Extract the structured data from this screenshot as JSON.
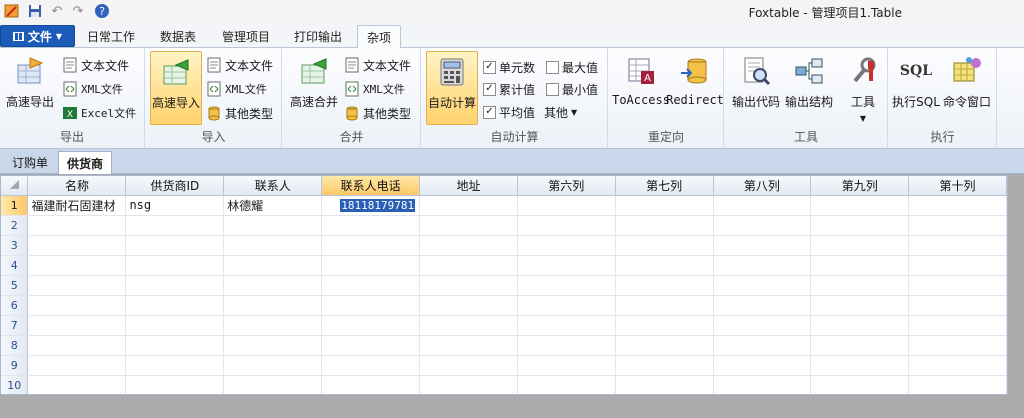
{
  "titlebar": {
    "title": "Foxtable - 管理项目1.Table"
  },
  "ribbon_tabs": {
    "file": "文件",
    "tabs": [
      "日常工作",
      "数据表",
      "管理项目",
      "打印输出",
      "杂项"
    ]
  },
  "groups": {
    "export": {
      "label": "导出",
      "big": "高速导出",
      "items": [
        "文本文件",
        "XML文件",
        "Excel文件"
      ]
    },
    "import": {
      "label": "导入",
      "big": "高速导入",
      "items": [
        "文本文件",
        "XML文件",
        "其他类型"
      ]
    },
    "merge": {
      "label": "合并",
      "big": "高速合并",
      "items": [
        "文本文件",
        "XML文件",
        "其他类型"
      ]
    },
    "autocalc": {
      "label": "自动计算",
      "big": "自动计算",
      "checks": [
        {
          "label": "单元数",
          "checked": "✓"
        },
        {
          "label": "最大值",
          "checked": ""
        },
        {
          "label": "累计值",
          "checked": "✓"
        },
        {
          "label": "最小值",
          "checked": ""
        },
        {
          "label": "平均值",
          "checked": "✓"
        }
      ],
      "other": "其他"
    },
    "redirect": {
      "label": "重定向",
      "toaccess": "ToAccess",
      "redirect": "Redirect"
    },
    "tools": {
      "label": "工具",
      "export_code": "输出代码",
      "export_struct": "输出结构",
      "tools": "工具"
    },
    "execute": {
      "label": "执行",
      "sql_icon_text": "SQL",
      "exec_sql": "执行SQL",
      "cmd_window": "命令窗口"
    }
  },
  "sheet_tabs": [
    "订购单",
    "供货商"
  ],
  "grid": {
    "columns": [
      "名称",
      "供货商ID",
      "联系人",
      "联系人电话",
      "地址",
      "第六列",
      "第七列",
      "第八列",
      "第九列",
      "第十列"
    ],
    "row_numbers": [
      "1",
      "2",
      "3",
      "4",
      "5",
      "6",
      "7",
      "8",
      "9",
      "10"
    ],
    "row1": [
      "福建耐石固建材",
      "nsg",
      "林德耀",
      "18118179781",
      "",
      "",
      "",
      "",
      "",
      ""
    ]
  },
  "colors": {
    "accent": "#1d5bb8",
    "highlight": "#ffd26e",
    "selection": "#2a5fb6"
  }
}
